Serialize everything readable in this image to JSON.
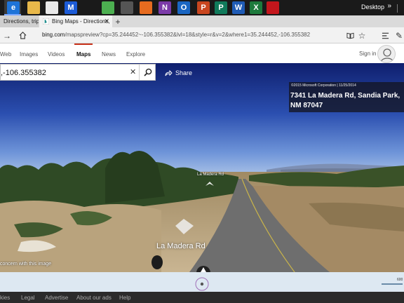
{
  "taskbar": {
    "apps": [
      {
        "icon": "edge-icon",
        "label": "e",
        "color": "#1e73d8"
      },
      {
        "icon": "file-explorer-icon",
        "label": "",
        "color": "#e8b84a"
      },
      {
        "icon": "store-icon",
        "label": "",
        "color": "#e9e9e9"
      },
      {
        "icon": "malwarebytes-icon",
        "label": "M",
        "color": "#1c5bd6"
      },
      {
        "icon": "chrome-icon",
        "label": "",
        "color": "#4caf50"
      },
      {
        "icon": "tool-icon",
        "label": "",
        "color": "#555555"
      },
      {
        "icon": "firefox-icon",
        "label": "",
        "color": "#e66b1f"
      },
      {
        "icon": "onenote-icon",
        "label": "N",
        "color": "#7b3aa8"
      },
      {
        "icon": "outlook-icon",
        "label": "O",
        "color": "#1a66c2"
      },
      {
        "icon": "powerpoint-icon",
        "label": "P",
        "color": "#c9461f"
      },
      {
        "icon": "publisher-icon",
        "label": "P",
        "color": "#107a5b"
      },
      {
        "icon": "word-icon",
        "label": "W",
        "color": "#1f5bb5"
      },
      {
        "icon": "excel-icon",
        "label": "X",
        "color": "#1d7a3c"
      },
      {
        "icon": "acrobat-icon",
        "label": "",
        "color": "#c4161c"
      }
    ],
    "desktop_label": "Desktop"
  },
  "tabs": [
    {
      "label": "Directions, trip",
      "active": false
    },
    {
      "label": "Bing Maps - Directions,",
      "active": true
    }
  ],
  "address_bar": {
    "url_host": "bing.com",
    "url_rest": "/mapspreview?cp=35.244452~-106.355382&lvl=18&style=r&v=2&where1=35.244452,-106.355382"
  },
  "bing_nav": {
    "items": [
      "Web",
      "Images",
      "Videos",
      "Maps",
      "News",
      "Explore"
    ],
    "active": "Maps",
    "signin": "Sign in"
  },
  "search": {
    "value": ",-106.355382",
    "share_label": "Share"
  },
  "streetside": {
    "copyright": "©2015 Microsoft Corporation | 11/25/2014",
    "address_line1": "7341 La Madera Rd, Sandia Park,",
    "address_line2": "NM 87047",
    "street_label_top": "La Madera Rd",
    "street_label_main": "La Madera Rd",
    "report_text": "concern with this image"
  },
  "minimap": {
    "scale_label": "600"
  },
  "footer": {
    "links": [
      "kies",
      "Legal",
      "Advertise",
      "About our ads",
      "Help"
    ]
  }
}
